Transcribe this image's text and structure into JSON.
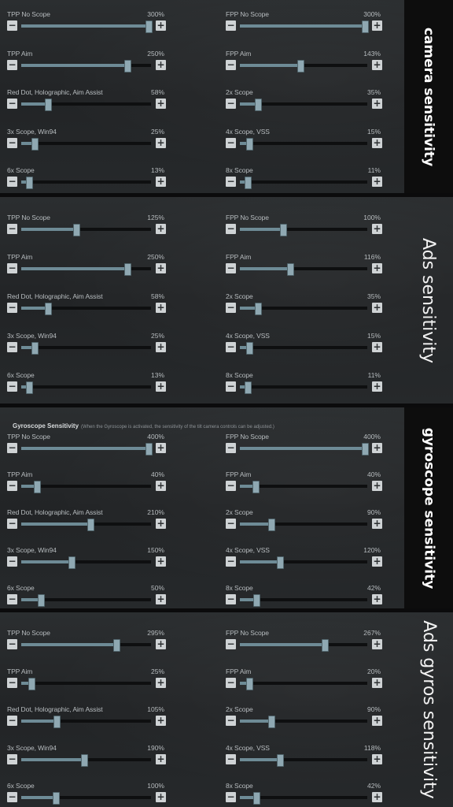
{
  "panels": [
    {
      "name": "camera",
      "title": "camera sensitivity",
      "title_style": "bold",
      "rows": [
        [
          {
            "label": "TPP No Scope",
            "value": "300%",
            "level": 1.0
          },
          {
            "label": "FPP No Scope",
            "value": "300%",
            "level": 1.0
          }
        ],
        [
          {
            "label": "TPP Aim",
            "value": "250%",
            "level": 0.83
          },
          {
            "label": "FPP Aim",
            "value": "143%",
            "level": 0.47
          }
        ],
        [
          {
            "label": "Red Dot, Holographic, Aim Assist",
            "value": "58%",
            "level": 0.19
          },
          {
            "label": "2x Scope",
            "value": "35%",
            "level": 0.12
          }
        ],
        [
          {
            "label": "3x Scope, Win94",
            "value": "25%",
            "level": 0.08
          },
          {
            "label": "4x Scope, VSS",
            "value": "15%",
            "level": 0.05
          }
        ],
        [
          {
            "label": "6x Scope",
            "value": "13%",
            "level": 0.04
          },
          {
            "label": "8x Scope",
            "value": "11%",
            "level": 0.04
          }
        ]
      ]
    },
    {
      "name": "ads",
      "title": "Ads sensitivity",
      "title_style": "light",
      "rows": [
        [
          {
            "label": "TPP No Scope",
            "value": "125%",
            "level": 0.42
          },
          {
            "label": "FPP No Scope",
            "value": "100%",
            "level": 0.33
          }
        ],
        [
          {
            "label": "TPP Aim",
            "value": "250%",
            "level": 0.83
          },
          {
            "label": "FPP Aim",
            "value": "116%",
            "level": 0.39
          }
        ],
        [
          {
            "label": "Red Dot, Holographic, Aim Assist",
            "value": "58%",
            "level": 0.19
          },
          {
            "label": "2x Scope",
            "value": "35%",
            "level": 0.12
          }
        ],
        [
          {
            "label": "3x Scope, Win94",
            "value": "25%",
            "level": 0.08
          },
          {
            "label": "4x Scope, VSS",
            "value": "15%",
            "level": 0.05
          }
        ],
        [
          {
            "label": "6x Scope",
            "value": "13%",
            "level": 0.04
          },
          {
            "label": "8x Scope",
            "value": "11%",
            "level": 0.04
          }
        ]
      ]
    },
    {
      "name": "gyroscope",
      "title": "gyroscope sensitivity",
      "title_style": "bold",
      "header": "Gyroscope Sensitivity",
      "header_note": "(When the Gyroscope is activated, the sensitivity of the tilt camera controls can be adjusted.)",
      "rows": [
        [
          {
            "label": "TPP No Scope",
            "value": "400%",
            "level": 1.0
          },
          {
            "label": "FPP No Scope",
            "value": "400%",
            "level": 1.0
          }
        ],
        [
          {
            "label": "TPP Aim",
            "value": "40%",
            "level": 0.1
          },
          {
            "label": "FPP Aim",
            "value": "40%",
            "level": 0.1
          }
        ],
        [
          {
            "label": "Red Dot, Holographic, Aim Assist",
            "value": "210%",
            "level": 0.53
          },
          {
            "label": "2x Scope",
            "value": "90%",
            "level": 0.23
          }
        ],
        [
          {
            "label": "3x Scope, Win94",
            "value": "150%",
            "level": 0.38
          },
          {
            "label": "4x Scope, VSS",
            "value": "120%",
            "level": 0.3
          }
        ],
        [
          {
            "label": "6x Scope",
            "value": "50%",
            "level": 0.13
          },
          {
            "label": "8x Scope",
            "value": "42%",
            "level": 0.11
          }
        ]
      ]
    },
    {
      "name": "ads-gyro",
      "title": "Ads gyros sensitivity",
      "title_style": "light",
      "rows": [
        [
          {
            "label": "TPP No Scope",
            "value": "295%",
            "level": 0.74
          },
          {
            "label": "FPP No Scope",
            "value": "267%",
            "level": 0.67
          }
        ],
        [
          {
            "label": "TPP Aim",
            "value": "25%",
            "level": 0.06
          },
          {
            "label": "FPP Aim",
            "value": "20%",
            "level": 0.05
          }
        ],
        [
          {
            "label": "Red Dot, Holographic, Aim Assist",
            "value": "105%",
            "level": 0.26
          },
          {
            "label": "2x Scope",
            "value": "90%",
            "level": 0.23
          }
        ],
        [
          {
            "label": "3x Scope, Win94",
            "value": "190%",
            "level": 0.48
          },
          {
            "label": "4x Scope, VSS",
            "value": "118%",
            "level": 0.3
          }
        ],
        [
          {
            "label": "6x Scope",
            "value": "100%",
            "level": 0.25
          },
          {
            "label": "8x Scope",
            "value": "42%",
            "level": 0.11
          }
        ]
      ]
    }
  ],
  "buttons": {
    "minus": "−",
    "plus": "+"
  },
  "colors": {
    "fill": "#6e8b96",
    "knob": "#8fa8b2",
    "track": "#0e0f10",
    "text": "#b7bcbf",
    "button": "#cfd3d5"
  }
}
